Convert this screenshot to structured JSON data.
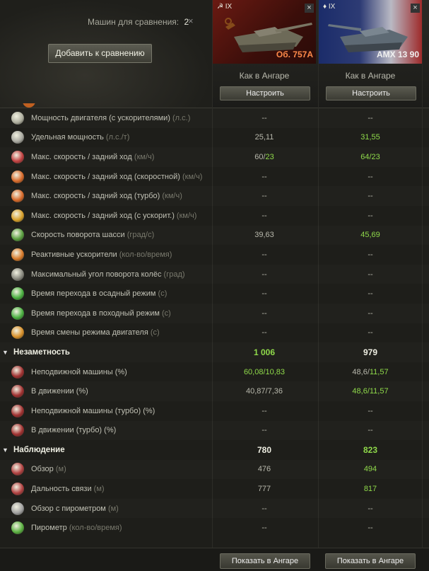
{
  "header": {
    "vehicles_label": "Машин для сравнения:",
    "vehicles_count": "2",
    "clear_icon": "close-icon",
    "add_button": "Добавить к сравнению"
  },
  "vehicles": [
    {
      "tier": "IX",
      "name": "Об. 757А",
      "config": "Как в Ангаре",
      "configure_button": "Настроить",
      "hangar_button": "Показать в Ангаре",
      "close_icon": "close-icon"
    },
    {
      "tier": "IX",
      "name": "AMX 13 90",
      "config": "Как в Ангаре",
      "configure_button": "Настроить",
      "hangar_button": "Показать в Ангаре",
      "close_icon": "close-icon"
    }
  ],
  "rows": [
    {
      "label": "Мощность двигателя (с ускорителями)",
      "unit": "(л.с.)",
      "v1": "--",
      "v2": "--",
      "icon": "engine-icon",
      "color": "#b0b0a0"
    },
    {
      "label": "Удельная мощность",
      "unit": "(л.с./т)",
      "v1": "25,11",
      "v2": "31,55",
      "v2_green": true,
      "icon": "power-ratio-icon",
      "color": "#a8a8a0"
    },
    {
      "label": "Макс. скорость / задний ход",
      "unit": "(км/ч)",
      "v1": "60/23",
      "v1_green_part": "23",
      "v2": "64/23",
      "v2_green": true,
      "icon": "speed-icon",
      "color": "#c04040"
    },
    {
      "label": "Макс. скорость / задний ход (скоростной)",
      "unit": "(км/ч)",
      "v1": "--",
      "v2": "--",
      "icon": "speed-mode-icon",
      "color": "#d86a2a"
    },
    {
      "label": "Макс. скорость / задний ход (турбо)",
      "unit": "(км/ч)",
      "v1": "--",
      "v2": "--",
      "icon": "turbo-icon",
      "color": "#d86a2a"
    },
    {
      "label": "Макс. скорость / задний ход (с ускорит.)",
      "unit": "(км/ч)",
      "v1": "--",
      "v2": "--",
      "icon": "boost-icon",
      "color": "#d8a02a"
    },
    {
      "label": "Скорость поворота шасси",
      "unit": "(град/с)",
      "v1": "39,63",
      "v2": "45,69",
      "v2_green": true,
      "icon": "traverse-icon",
      "color": "#5aa040"
    },
    {
      "label": "Реактивные ускорители",
      "unit": "(кол-во/время)",
      "v1": "--",
      "v2": "--",
      "icon": "rocket-icon",
      "color": "#d87a2a"
    },
    {
      "label": "Максимальный угол поворота колёс",
      "unit": "(град)",
      "v1": "--",
      "v2": "--",
      "icon": "wheel-angle-icon",
      "color": "#8a8a80"
    },
    {
      "label": "Время перехода в осадный режим",
      "unit": "(с)",
      "v1": "--",
      "v2": "--",
      "icon": "siege-icon",
      "color": "#4ab040"
    },
    {
      "label": "Время перехода в походный режим",
      "unit": "(с)",
      "v1": "--",
      "v2": "--",
      "icon": "travel-icon",
      "color": "#4ab040"
    },
    {
      "label": "Время смены режима двигателя",
      "unit": "(с)",
      "v1": "--",
      "v2": "--",
      "icon": "engine-mode-icon",
      "color": "#d8902a"
    },
    {
      "head": true,
      "label": "Незаметность",
      "v1": "1 006",
      "v1_green": true,
      "v2": "979"
    },
    {
      "label": "Неподвижной машины (%)",
      "unit": "",
      "v1": "60,08/10,83",
      "v1_green": true,
      "v2": "48,6/11,57",
      "v2_green_part": "11,57",
      "icon": "camo-static-icon",
      "color": "#a03030"
    },
    {
      "label": "В движении (%)",
      "unit": "",
      "v1": "40,87/7,36",
      "v2": "48,6/11,57",
      "v2_green": true,
      "icon": "camo-moving-icon",
      "color": "#a03030"
    },
    {
      "label": "Неподвижной машины (турбо) (%)",
      "unit": "",
      "v1": "--",
      "v2": "--",
      "icon": "camo-static-turbo-icon",
      "color": "#a03030"
    },
    {
      "label": "В движении (турбо) (%)",
      "unit": "",
      "v1": "--",
      "v2": "--",
      "icon": "camo-moving-turbo-icon",
      "color": "#a03030"
    },
    {
      "head": true,
      "label": "Наблюдение",
      "v1": "780",
      "v2": "823",
      "v2_green": true
    },
    {
      "label": "Обзор",
      "unit": "(м)",
      "v1": "476",
      "v2": "494",
      "v2_green": true,
      "icon": "view-range-icon",
      "color": "#b04040"
    },
    {
      "label": "Дальность связи",
      "unit": "(м)",
      "v1": "777",
      "v2": "817",
      "v2_green": true,
      "icon": "radio-icon",
      "color": "#b04040"
    },
    {
      "label": "Обзор с пирометром",
      "unit": "(м)",
      "v1": "--",
      "v2": "--",
      "icon": "pyrometer-view-icon",
      "color": "#a0a0a0"
    },
    {
      "label": "Пирометр",
      "unit": "(кол-во/время)",
      "v1": "--",
      "v2": "--",
      "icon": "pyrometer-icon",
      "color": "#5ab040"
    }
  ]
}
